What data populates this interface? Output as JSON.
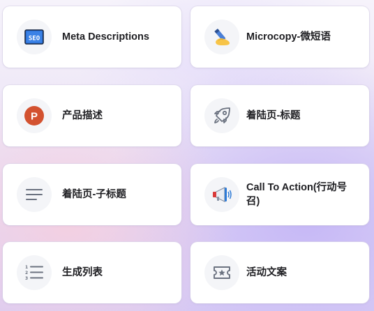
{
  "cards": [
    {
      "label": "Meta Descriptions",
      "icon": "seo-icon"
    },
    {
      "label": "Microcopy-微短语",
      "icon": "pen-writing-icon"
    },
    {
      "label": "产品描述",
      "icon": "powerpoint-icon"
    },
    {
      "label": "着陆页-标题",
      "icon": "rocket-icon"
    },
    {
      "label": "着陆页-子标题",
      "icon": "lines-icon"
    },
    {
      "label": "Call To Action(行动号召)",
      "icon": "megaphone-icon"
    },
    {
      "label": "生成列表",
      "icon": "numbered-list-icon"
    },
    {
      "label": "活动文案",
      "icon": "ticket-star-icon"
    }
  ],
  "colors": {
    "powerpoint": "#d35230",
    "seo_blue": "#2a6fd6",
    "icon_gray": "#6b7280"
  }
}
